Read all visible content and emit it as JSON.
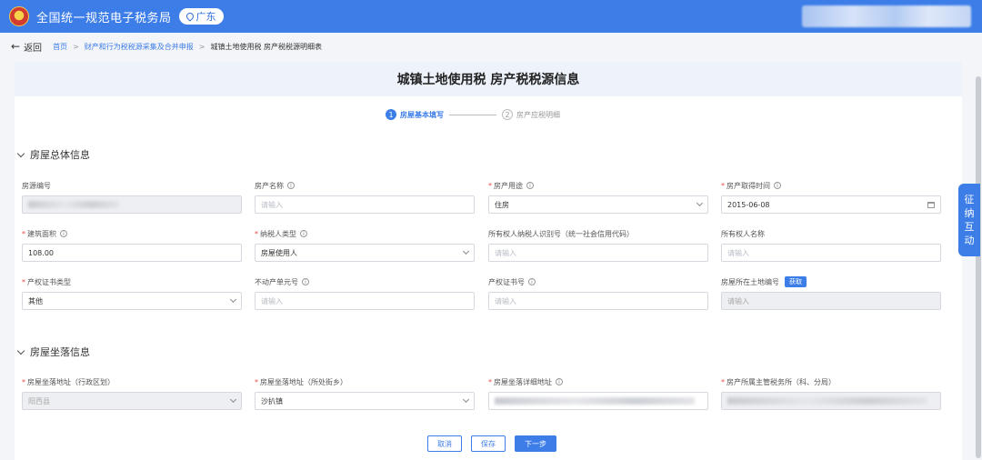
{
  "header": {
    "app_title": "全国统一规范电子税务局",
    "region": "广东"
  },
  "nav": {
    "back_label": "返回",
    "breadcrumbs": [
      "首页",
      "财产和行为税税源采集及合并申报",
      "城镇土地使用税 房产税税源明细表"
    ],
    "separator": ">"
  },
  "page": {
    "title": "城镇土地使用税 房产税税源信息"
  },
  "steps": [
    {
      "num": "1",
      "label": "房屋基本填写"
    },
    {
      "num": "2",
      "label": "房产应税明细"
    }
  ],
  "section1": {
    "title": "房屋总体信息",
    "fields": {
      "source_no": {
        "label": "房源编号"
      },
      "property_name": {
        "label": "房产名称",
        "placeholder": "请输入"
      },
      "property_use": {
        "label": "房产用途",
        "value": "住房"
      },
      "acquire_time": {
        "label": "房产取得时间",
        "value": "2015-06-08"
      },
      "area": {
        "label": "建筑面积",
        "value": "108.00"
      },
      "taxpayer_type": {
        "label": "纳税人类型",
        "value": "房屋使用人"
      },
      "owner_id": {
        "label": "所有权人纳税人识别号（统一社会信用代码）",
        "placeholder": "请输入"
      },
      "owner_name": {
        "label": "所有权人名称",
        "placeholder": "请输入"
      },
      "cert_type": {
        "label": "产权证书类型",
        "value": "其他"
      },
      "unit_no": {
        "label": "不动产单元号",
        "placeholder": "请输入"
      },
      "cert_no": {
        "label": "产权证书号",
        "placeholder": "请输入"
      },
      "land_no": {
        "label": "房屋所在土地编号",
        "fetch_label": "获取",
        "placeholder": "请输入"
      }
    }
  },
  "section2": {
    "title": "房屋坐落信息",
    "fields": {
      "admin_region": {
        "label": "房屋坐落地址（行政区划）",
        "value": "阳西县"
      },
      "street": {
        "label": "房屋坐落地址（所处街乡）",
        "value": "沙扒镇"
      },
      "detail_addr": {
        "label": "房屋坐落详细地址"
      },
      "tax_office": {
        "label": "房产所属主管税务所（科、分局）"
      }
    }
  },
  "actions": {
    "cancel": "取消",
    "save": "保存",
    "next": "下一步"
  },
  "side_tab": [
    "征",
    "纳",
    "互",
    "动"
  ],
  "colors": {
    "primary": "#3c7de8",
    "required": "#e34c4c"
  }
}
